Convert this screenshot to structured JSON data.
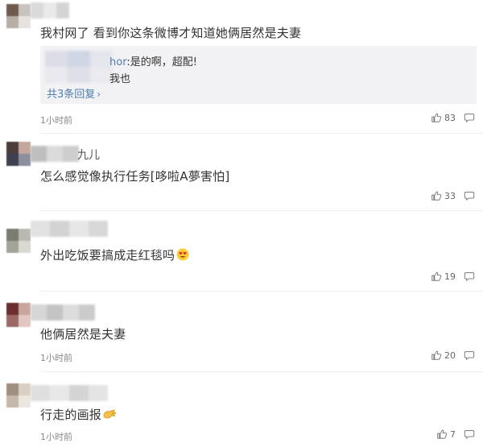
{
  "comments": [
    {
      "content": "我村网了 看到你这条微博才知道她俩居然是夫妻",
      "time": "1小时前",
      "likes": "83",
      "reply_preview": {
        "username_partial": "hor",
        "separator": ":",
        "text1": "是的啊，超配!",
        "text2": "我也",
        "more_label": "共3条回复"
      }
    },
    {
      "username_partial": "九儿",
      "content": "怎么感觉像执行任务[哆啦A夢害怕]",
      "time": "",
      "likes": "33"
    },
    {
      "content": "外出吃饭要搞成走红毯吗",
      "emoji": "smiling-face-with-heart-eyes",
      "time": "",
      "likes": "19"
    },
    {
      "content": "他俩居然是夫妻",
      "time": "1小时前",
      "likes": "20"
    },
    {
      "content": "行走的画报",
      "emoji": "clapping-hands",
      "time": "1小时前",
      "likes": "7"
    }
  ],
  "colors": {
    "text": "#333333",
    "meta": "#888888",
    "link": "#507daf",
    "reply_bg": "#f2f2f5",
    "divider": "#eeeeee"
  },
  "icons": {
    "like": "thumbs-up-icon",
    "comment": "comment-bubble-icon",
    "more": "chevron-right-icon"
  }
}
